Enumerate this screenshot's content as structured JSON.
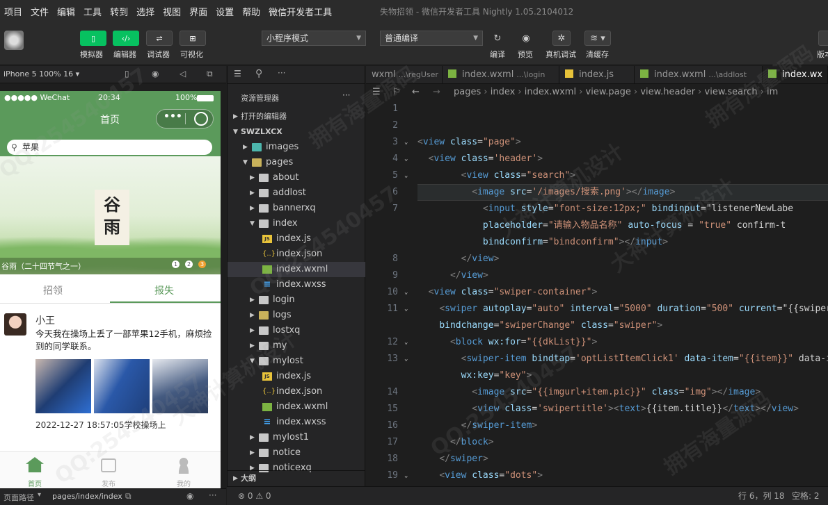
{
  "menu": [
    "项目",
    "文件",
    "编辑",
    "工具",
    "转到",
    "选择",
    "视图",
    "界面",
    "设置",
    "帮助",
    "微信开发者工具"
  ],
  "window_title": "失物招领 - 微信开发者工具 Nightly 1.05.2104012",
  "toolbar": {
    "simulator": "模拟器",
    "editor": "编辑器",
    "debugger": "调试器",
    "visual": "可视化",
    "mode_select": "小程序模式",
    "compile_select": "普通编译",
    "compile": "编译",
    "preview": "预览",
    "remote_debug": "真机调试",
    "clear_cache": "清缓存",
    "version": "版本"
  },
  "simulator": {
    "device": "iPhone 5 100% 16",
    "status_left": "●●●●● WeChat",
    "status_time": "20:34",
    "status_battery": "100%",
    "nav_title": "首页",
    "search_value": "苹果",
    "banner_text": "谷雨",
    "banner_caption": "谷雨（二十四节气之一）",
    "dots": [
      "1",
      "2",
      "3"
    ],
    "tabs": [
      "招领",
      "报失"
    ],
    "active_tab": 1,
    "post": {
      "user": "小王",
      "content": "今天我在操场上丢了一部苹果12手机，麻烦捡到的同学联系。",
      "time_place": "2022-12-27 18:57:05学校操场上"
    },
    "tabbar": [
      "首页",
      "发布",
      "我的"
    ],
    "footer_label": "页面路径",
    "footer_path": "pages/index/index"
  },
  "explorer": {
    "title": "资源管理器",
    "open_editors": "打开的编辑器",
    "project": "SWZLXCX",
    "outline": "大纲",
    "tree": [
      {
        "label": "images",
        "type": "folder",
        "depth": 1,
        "open": false
      },
      {
        "label": "pages",
        "type": "folder",
        "depth": 1,
        "open": true
      },
      {
        "label": "about",
        "type": "folder",
        "depth": 2,
        "open": false
      },
      {
        "label": "addlost",
        "type": "folder",
        "depth": 2,
        "open": false
      },
      {
        "label": "bannerxq",
        "type": "folder",
        "depth": 2,
        "open": false
      },
      {
        "label": "index",
        "type": "folder",
        "depth": 2,
        "open": true
      },
      {
        "label": "index.js",
        "type": "js",
        "depth": 3
      },
      {
        "label": "index.json",
        "type": "json",
        "depth": 3
      },
      {
        "label": "index.wxml",
        "type": "wxml",
        "depth": 3,
        "selected": true
      },
      {
        "label": "index.wxss",
        "type": "wxss",
        "depth": 3
      },
      {
        "label": "login",
        "type": "folder",
        "depth": 2,
        "open": false
      },
      {
        "label": "logs",
        "type": "folder",
        "depth": 2,
        "open": false
      },
      {
        "label": "lostxq",
        "type": "folder",
        "depth": 2,
        "open": false
      },
      {
        "label": "my",
        "type": "folder",
        "depth": 2,
        "open": false
      },
      {
        "label": "mylost",
        "type": "folder",
        "depth": 2,
        "open": true
      },
      {
        "label": "index.js",
        "type": "js",
        "depth": 3
      },
      {
        "label": "index.json",
        "type": "json",
        "depth": 3
      },
      {
        "label": "index.wxml",
        "type": "wxml",
        "depth": 3
      },
      {
        "label": "index.wxss",
        "type": "wxss",
        "depth": 3
      },
      {
        "label": "mylost1",
        "type": "folder",
        "depth": 2,
        "open": false
      },
      {
        "label": "notice",
        "type": "folder",
        "depth": 2,
        "open": false
      },
      {
        "label": "noticexq",
        "type": "folder",
        "depth": 2,
        "open": false
      }
    ]
  },
  "editor_tabs": [
    {
      "name": "wxml",
      "sub": "...\\regUser"
    },
    {
      "name": "index.wxml",
      "sub": "...\\login"
    },
    {
      "name": "index.js",
      "sub": ""
    },
    {
      "name": "index.wxml",
      "sub": "...\\addlost"
    },
    {
      "name": "index.wx",
      "sub": ""
    }
  ],
  "breadcrumb": [
    "pages",
    "index",
    "index.wxml",
    "view.page",
    "view.header",
    "view.search",
    "im"
  ],
  "code_lines": [
    {
      "n": "1",
      "text": ""
    },
    {
      "n": "2",
      "text": ""
    },
    {
      "n": "3",
      "text": "<view class=\"page\">"
    },
    {
      "n": "4",
      "text": "  <view class='header'>"
    },
    {
      "n": "5",
      "text": "        <view class=\"search\">"
    },
    {
      "n": "6",
      "text": "          <image src='/images/搜索.png'></image>"
    },
    {
      "n": "7",
      "text": "            <input style=\"font-size:12px;\" bindinput=\"listenerNewLabe"
    },
    {
      "n": "",
      "text": "            placeholder=\"请输入物品名称\" auto-focus = \"true\" confirm-t"
    },
    {
      "n": "",
      "text": "            bindconfirm=\"bindconfirm\"></input>"
    },
    {
      "n": "8",
      "text": "        </view>"
    },
    {
      "n": "9",
      "text": "      </view>"
    },
    {
      "n": "10",
      "text": "  <view class=\"swiper-container\">"
    },
    {
      "n": "11",
      "text": "    <swiper autoplay=\"auto\" interval=\"5000\" duration=\"500\" current=\"{{swiperC"
    },
    {
      "n": "",
      "text": "    bindchange=\"swiperChange\" class=\"swiper\">"
    },
    {
      "n": "12",
      "text": "      <block wx:for=\"{{dkList}}\">"
    },
    {
      "n": "13",
      "text": "        <swiper-item bindtap='optListItemClick1' data-item=\"{{item}}\" data-id"
    },
    {
      "n": "",
      "text": "        wx:key=\"key\">"
    },
    {
      "n": "14",
      "text": "          <image src=\"{{imgurl+item.pic}}\" class=\"img\"></image>"
    },
    {
      "n": "15",
      "text": "          <view class='swipertitle'><text>{{item.title}}</text></view>"
    },
    {
      "n": "16",
      "text": "        </swiper-item>"
    },
    {
      "n": "17",
      "text": "      </block>"
    },
    {
      "n": "18",
      "text": "    </swiper>"
    },
    {
      "n": "19",
      "text": "    <view class=\"dots\">"
    }
  ],
  "status": {
    "problems": "⊗ 0 ⚠ 0",
    "position": "行 6，列 18",
    "indent": "空格: 2"
  },
  "watermarks": [
    "QQ:254540457",
    "大神计算机设计",
    "拥有海量源码"
  ]
}
